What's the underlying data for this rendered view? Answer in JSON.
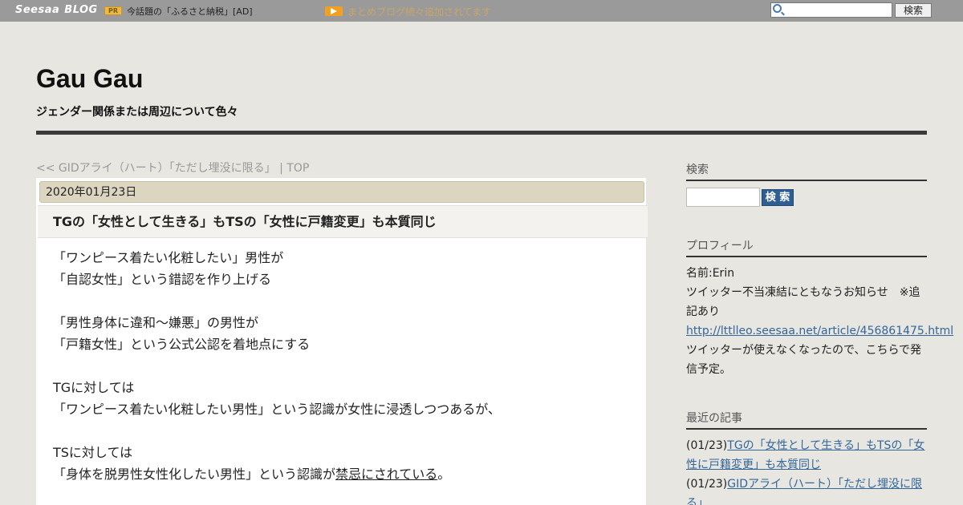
{
  "topbar": {
    "logo_seesaa": "Seesaa",
    "logo_blog": "BLOG",
    "pr_badge": "PR",
    "pr_text": "今話題の「ふるさと納税」[AD]",
    "notice_text": "まとめブログ続々追加されてます",
    "search_button": "検索"
  },
  "header": {
    "title": "Gau Gau",
    "description": "ジェンダー関係または周辺について色々"
  },
  "nav": {
    "prev_link": "<< GIDアライ（ハート）「ただし埋没に限る」",
    "separator": " | ",
    "top_link": "TOP"
  },
  "article": {
    "date": "2020年01月23日",
    "title": "TGの「女性として生きる」もTSの「女性に戸籍変更」も本質同じ",
    "lines": [
      "「ワンピース着たい化粧したい」男性が",
      "「自認女性」という錯認を作り上げる",
      "",
      "「男性身体に違和～嫌悪」の男性が",
      "「戸籍女性」という公式公認を着地点にする",
      "",
      "TGに対しては",
      "「ワンピース着たい化粧したい男性」という認識が女性に浸透しつつあるが、",
      "",
      "TSに対しては"
    ],
    "last_line_before": "「身体を脱男性女性化したい男性」という認識が",
    "last_line_underlined": "禁忌にされている",
    "last_line_after": "。"
  },
  "sidebar": {
    "search_heading": "検索",
    "search_button": "検 索",
    "profile_heading": "プロフィール",
    "profile_name": "名前:Erin",
    "profile_notice": "ツイッター不当凍結にともなうお知らせ　※追記あり",
    "profile_link": "http://lttlleo.seesaa.net/article/456861475.html",
    "profile_note": "ツイッターが使えなくなったので、こちらで発信予定。",
    "recent_heading": "最近の記事",
    "recent": [
      {
        "date": "(01/23)",
        "title": "TGの「女性として生きる」もTSの「女性に戸籍変更」も本質同じ"
      },
      {
        "date": "(01/23)",
        "title": "GIDアライ（ハート）「ただし埋没に限る」"
      }
    ]
  }
}
